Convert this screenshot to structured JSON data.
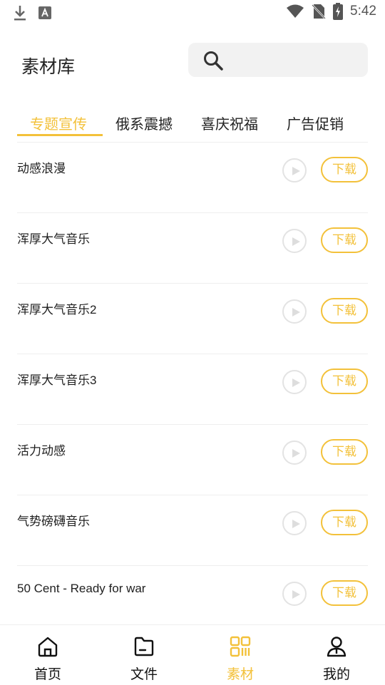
{
  "status_bar": {
    "time": "5:42"
  },
  "header": {
    "title": "素材库",
    "search_placeholder": ""
  },
  "tabs": [
    {
      "label": "专题宣传",
      "active": true
    },
    {
      "label": "俄系震撼",
      "active": false
    },
    {
      "label": "喜庆祝福",
      "active": false
    },
    {
      "label": "广告促销",
      "active": false
    }
  ],
  "items": [
    {
      "title": "动感浪漫",
      "download_label": "下载"
    },
    {
      "title": "浑厚大气音乐",
      "download_label": "下载"
    },
    {
      "title": "浑厚大气音乐2",
      "download_label": "下载"
    },
    {
      "title": "浑厚大气音乐3",
      "download_label": "下载"
    },
    {
      "title": "活力动感",
      "download_label": "下载"
    },
    {
      "title": "气势磅礴音乐",
      "download_label": "下载"
    },
    {
      "title": "50 Cent - Ready for war",
      "download_label": "下载"
    }
  ],
  "bottom_nav": [
    {
      "label": "首页",
      "icon": "home-icon",
      "active": false
    },
    {
      "label": "文件",
      "icon": "folder-icon",
      "active": false
    },
    {
      "label": "素材",
      "icon": "qr-grid-icon",
      "active": true
    },
    {
      "label": "我的",
      "icon": "user-icon",
      "active": false
    }
  ],
  "colors": {
    "accent": "#f3c13a",
    "text": "#1a1a1a",
    "divider": "#eeeeee"
  }
}
